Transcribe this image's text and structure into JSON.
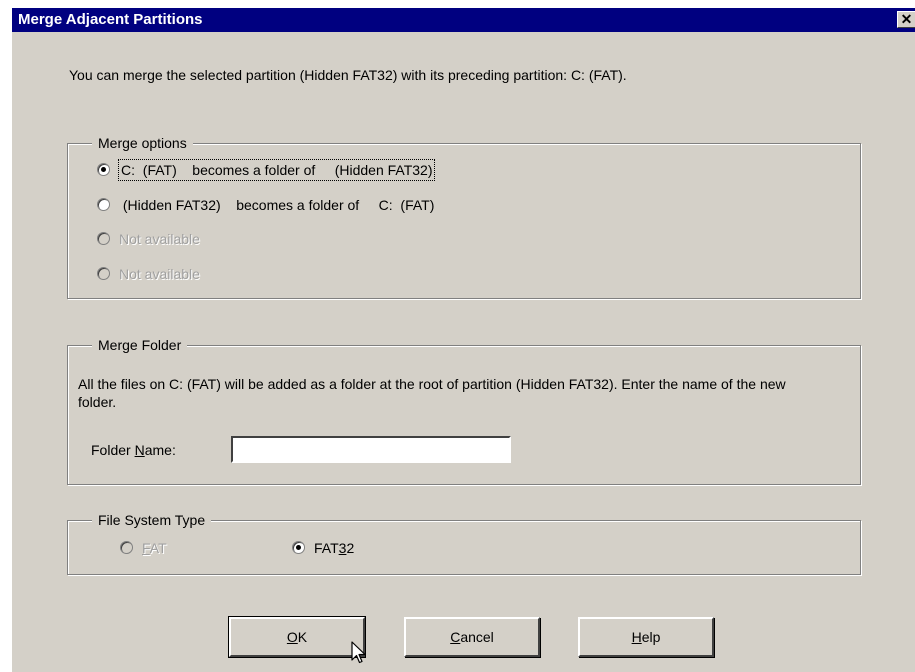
{
  "dialog": {
    "title": "Merge Adjacent Partitions",
    "close_glyph": "✕",
    "intro_text": "You can merge the selected partition  (Hidden FAT32)  with its preceding partition:  C:  (FAT)."
  },
  "merge_options": {
    "legend": "Merge options",
    "options": [
      {
        "label": "C:  (FAT)    becomes a folder of     (Hidden FAT32)",
        "checked": true,
        "enabled": true
      },
      {
        "label": " (Hidden FAT32)    becomes a folder of     C:  (FAT)",
        "checked": false,
        "enabled": true
      },
      {
        "label": "Not available",
        "checked": false,
        "enabled": false
      },
      {
        "label": "Not available",
        "checked": false,
        "enabled": false
      }
    ]
  },
  "merge_folder": {
    "legend": "Merge Folder",
    "description": "All the files on  C:  (FAT)  will be added as a folder at the root of partition  (Hidden FAT32).  Enter the name of the new folder.",
    "folder_name_label_pre": "Folder ",
    "folder_name_label_accel": "N",
    "folder_name_label_post": "ame:",
    "folder_name_value": ""
  },
  "file_system_type": {
    "legend": "File System Type",
    "fat_accel": "F",
    "fat_rest": "AT",
    "fat_checked": false,
    "fat_enabled": false,
    "fat32_pre": "FAT",
    "fat32_accel": "3",
    "fat32_post": "2",
    "fat32_checked": true
  },
  "buttons": {
    "ok_accel": "O",
    "ok_rest": "K",
    "cancel_accel": "C",
    "cancel_rest": "ancel",
    "help_accel": "H",
    "help_rest": "elp"
  },
  "colors": {
    "title_bar": "#000080",
    "dialog_face": "#d4d0c8",
    "disabled_text": "#a0a0a0"
  },
  "icons": {
    "close": "close-icon",
    "cursor": "mouse-pointer-icon"
  }
}
